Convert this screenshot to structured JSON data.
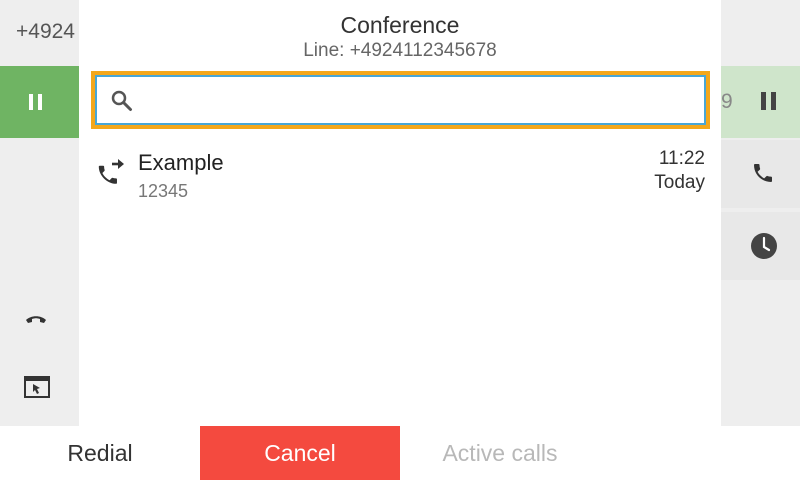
{
  "background": {
    "left_number": "+4924",
    "right_digit": "9"
  },
  "dialog": {
    "title": "Conference",
    "subtitle": "Line: +4924112345678",
    "search": {
      "value": "",
      "placeholder": ""
    },
    "entries": [
      {
        "name": "Example",
        "number": "12345",
        "time": "11:22",
        "date": "Today",
        "icon": "outgoing-call-icon"
      }
    ]
  },
  "bottom_bar": {
    "redial_label": "Redial",
    "cancel_label": "Cancel",
    "active_calls_label": "Active calls"
  },
  "colors": {
    "hold_green": "#6fb463",
    "focus_orange": "#f3a71b",
    "cancel_red": "#f44a3f",
    "input_border": "#48a6d6"
  }
}
